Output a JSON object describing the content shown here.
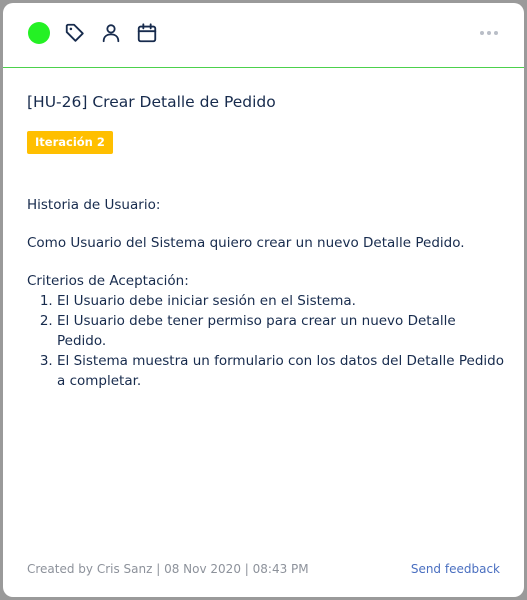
{
  "colors": {
    "status_dot": "#24f124",
    "badge_bg": "#ffbf00",
    "toolbar_border": "#4cd14c",
    "link": "#4a6fc0"
  },
  "toolbar": {
    "icons": [
      "status-dot",
      "tag-icon",
      "user-icon",
      "calendar-icon",
      "more-options-icon"
    ]
  },
  "card": {
    "title": "[HU-26] Crear Detalle de Pedido",
    "badge": "Iteración 2",
    "body": {
      "heading": "Historia de Usuario:",
      "story": "Como Usuario del Sistema quiero crear un nuevo Detalle Pedido.",
      "criteria_heading": "Criterios de Aceptación:",
      "criteria": [
        "El Usuario debe iniciar sesión en el Sistema.",
        "El Usuario debe tener permiso para crear un nuevo Detalle Pedido.",
        "El Sistema muestra un formulario con los datos del Detalle Pedido a completar."
      ]
    }
  },
  "footer": {
    "created": "Created by Cris Sanz | 08 Nov 2020 | 08:43 PM",
    "feedback": "Send feedback"
  }
}
